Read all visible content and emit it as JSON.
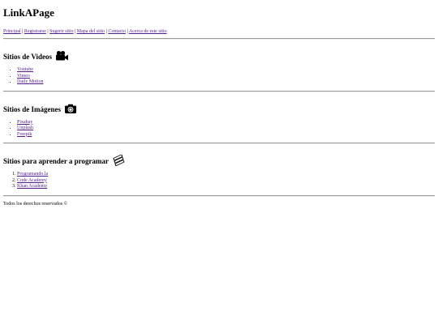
{
  "header": {
    "title": "LinkAPage"
  },
  "nav": {
    "items": [
      {
        "label": "Principal"
      },
      {
        "label": "Registrarse"
      },
      {
        "label": "Sugerir sitio"
      },
      {
        "label": "Mapa del sitio"
      },
      {
        "label": "Contacto"
      },
      {
        "label": "Acerca de este sitio"
      }
    ],
    "separator": "|"
  },
  "sections": [
    {
      "title": "Sitios de Videos",
      "icon": "video-camera-icon",
      "list_type": "unordered",
      "links": [
        "Youtube",
        "Vimeo",
        "Daily Motion"
      ]
    },
    {
      "title": "Sitios de Imágenes",
      "icon": "camera-icon",
      "list_type": "unordered",
      "links": [
        "Pixabay",
        "Unplash",
        "Freepik"
      ]
    },
    {
      "title": "Sitios para aprender a programar",
      "icon": "books-icon",
      "list_type": "ordered",
      "links": [
        "Programando.la",
        "Code Academy",
        "Khan Academy"
      ]
    }
  ],
  "footer": {
    "text": "Todos los derechos reservados ©"
  },
  "colors": {
    "link": "#551a8b",
    "rule": "#9a9a9a"
  }
}
